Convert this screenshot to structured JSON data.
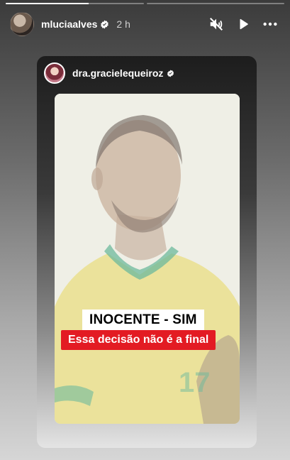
{
  "story": {
    "progress_segments": [
      {
        "fill": 0.6
      },
      {
        "fill": 0
      }
    ],
    "header": {
      "username": "mluciaalves",
      "time": "2 h",
      "icons": [
        "verified-icon",
        "mute-icon",
        "play-icon",
        "more-icon"
      ]
    }
  },
  "reshared_post": {
    "username": "dra.gracielequeiroz",
    "icons": [
      "verified-icon"
    ],
    "overlay": {
      "title": "INOCENTE - SIM",
      "subtitle": "Essa decisão não é a final"
    }
  },
  "colors": {
    "accent_red": "#e31b23",
    "text_white": "#ffffff",
    "jersey_yellow": "#e7d968",
    "collar_green": "#3aa37e"
  }
}
